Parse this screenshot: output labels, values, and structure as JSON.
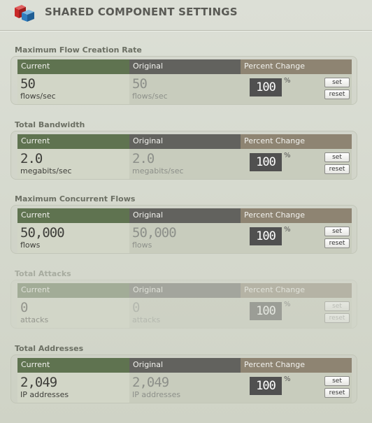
{
  "header": {
    "title": "SHARED COMPONENT SETTINGS",
    "logo_icon": "cube-logo-icon"
  },
  "columns": {
    "current": "Current",
    "original": "Original",
    "percent": "Percent Change"
  },
  "buttons": {
    "set": "set",
    "reset": "reset"
  },
  "percent_sign": "%",
  "sections": [
    {
      "title": "Maximum Flow Creation Rate",
      "current_value": "50",
      "current_unit": "flows/sec",
      "original_value": "50",
      "original_unit": "flows/sec",
      "percent": "100",
      "enabled": true
    },
    {
      "title": "Total Bandwidth",
      "current_value": "2.0",
      "current_unit": "megabits/sec",
      "original_value": "2.0",
      "original_unit": "megabits/sec",
      "percent": "100",
      "enabled": true
    },
    {
      "title": "Maximum Concurrent Flows",
      "current_value": "50,000",
      "current_unit": "flows",
      "original_value": "50,000",
      "original_unit": "flows",
      "percent": "100",
      "enabled": true
    },
    {
      "title": "Total Attacks",
      "current_value": "0",
      "current_unit": "attacks",
      "original_value": "0",
      "original_unit": "attacks",
      "percent": "100",
      "enabled": false
    },
    {
      "title": "Total Addresses",
      "current_value": "2,049",
      "current_unit": "IP addresses",
      "original_value": "2,049",
      "original_unit": "IP addresses",
      "percent": "100",
      "enabled": true
    }
  ],
  "colors": {
    "current_header": "#5f7350",
    "original_header": "#62625e",
    "percent_header": "#8e8472",
    "percent_box": "#505050"
  }
}
